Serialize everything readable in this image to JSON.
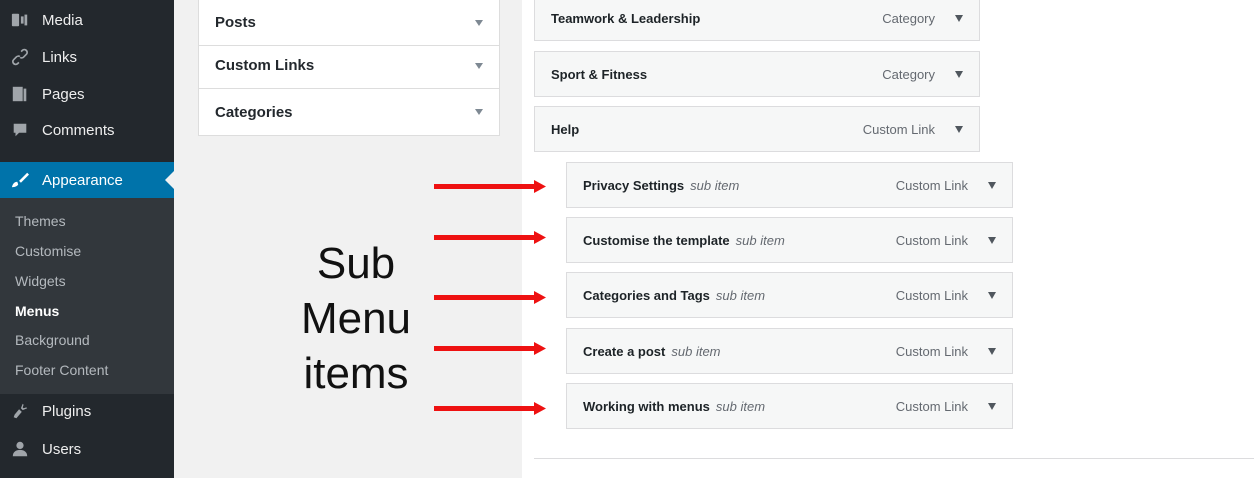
{
  "sidebar": {
    "items": [
      {
        "label": "Media",
        "icon": "media-icon"
      },
      {
        "label": "Links",
        "icon": "link-icon"
      },
      {
        "label": "Pages",
        "icon": "pages-icon"
      },
      {
        "label": "Comments",
        "icon": "comments-icon"
      },
      {
        "label": "Appearance",
        "icon": "brush-icon",
        "active": true
      },
      {
        "label": "Plugins",
        "icon": "plugin-icon"
      },
      {
        "label": "Users",
        "icon": "users-icon"
      }
    ],
    "submenu": [
      {
        "label": "Themes"
      },
      {
        "label": "Customise"
      },
      {
        "label": "Widgets"
      },
      {
        "label": "Menus",
        "current": true
      },
      {
        "label": "Background"
      },
      {
        "label": "Footer Content"
      }
    ],
    "colors": {
      "bg": "#23282d",
      "submenu_bg": "#32373c",
      "active": "#0073aa"
    }
  },
  "add_items": {
    "sections": [
      {
        "label": "Posts"
      },
      {
        "label": "Custom Links"
      },
      {
        "label": "Categories"
      }
    ]
  },
  "menu_structure": {
    "items": [
      {
        "title": "Teamwork & Leadership",
        "type": "Category",
        "level": 0
      },
      {
        "title": "Sport & Fitness",
        "type": "Category",
        "level": 0
      },
      {
        "title": "Help",
        "type": "Custom Link",
        "level": 0
      },
      {
        "title": "Privacy Settings",
        "subtag": "sub item",
        "type": "Custom Link",
        "level": 1
      },
      {
        "title": "Customise the template",
        "subtag": "sub item",
        "type": "Custom Link",
        "level": 1
      },
      {
        "title": "Categories and Tags",
        "subtag": "sub item",
        "type": "Custom Link",
        "level": 1
      },
      {
        "title": "Create a post",
        "subtag": "sub item",
        "type": "Custom Link",
        "level": 1
      },
      {
        "title": "Working with menus",
        "subtag": "sub item",
        "type": "Custom Link",
        "level": 1
      }
    ]
  },
  "annotation": {
    "lines": [
      "Sub",
      "Menu",
      "items"
    ],
    "arrow_color": "#ee1111"
  }
}
